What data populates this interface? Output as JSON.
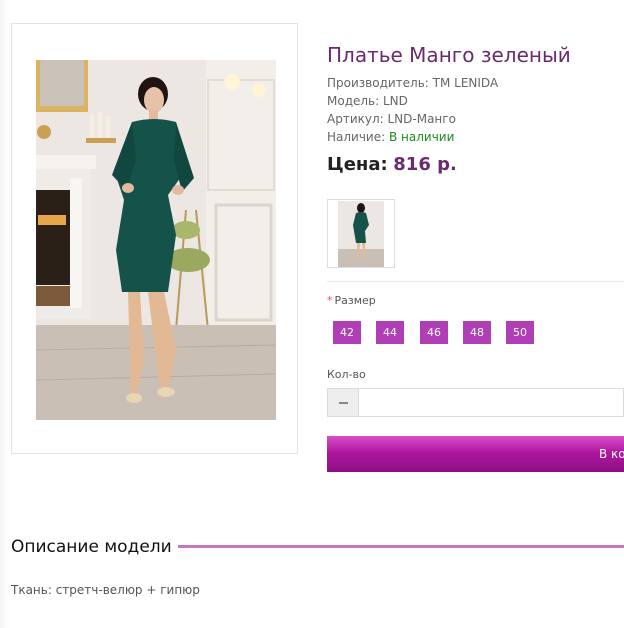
{
  "product": {
    "title": "Платье Манго зеленый",
    "manufacturer": "Производитель: TM LENIDA",
    "model": "Модель: LND",
    "article": "Артикул: LND-Манго",
    "availability_label": "Наличие: ",
    "availability_value": "В наличии",
    "price_label": "Цена:",
    "price_value": "816 р."
  },
  "options": {
    "size_label": "Размер",
    "required_mark": "*",
    "sizes": [
      "42",
      "44",
      "46",
      "48",
      "50"
    ]
  },
  "quantity": {
    "label": "Кол-во",
    "value": "",
    "minus_symbol": "−"
  },
  "cart": {
    "button_label": "В корзину"
  },
  "description": {
    "heading": "Описание модели",
    "text": "Ткань: стретч-велюр + гипюр"
  },
  "colors": {
    "title": "#6b2a6e",
    "accent": "#b03fb5",
    "in_stock": "#1c8a1c",
    "cart_button": "#b0179f",
    "heading_line": "#c577c7"
  },
  "icons": {
    "minus": "minus-icon"
  }
}
